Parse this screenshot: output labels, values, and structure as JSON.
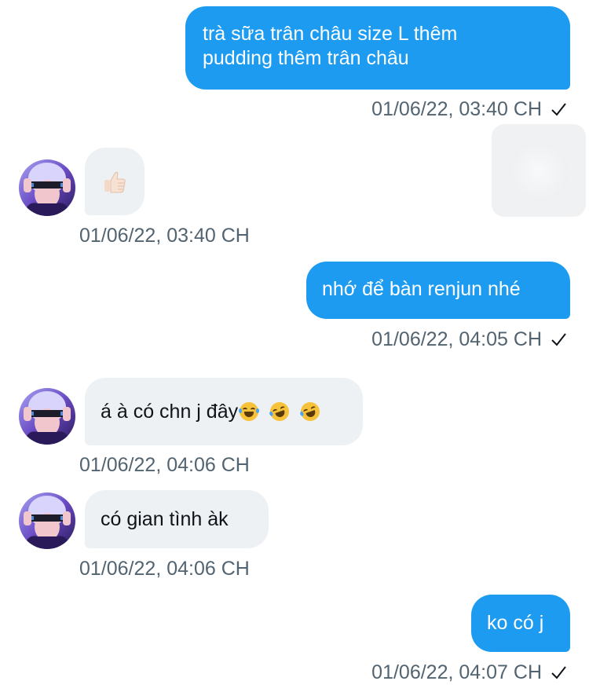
{
  "messages": [
    {
      "direction": "outgoing",
      "lines": [
        "trà sữa trân châu size L thêm",
        "pudding thêm trân châu"
      ],
      "time": "01/06/22, 03:40 CH"
    },
    {
      "direction": "incoming",
      "type": "reaction",
      "emoji_name": "thumbs-up-icon",
      "time": "01/06/22, 03:40 CH"
    },
    {
      "direction": "outgoing",
      "text": "nhớ để bàn renjun nhé",
      "time": "01/06/22, 04:05 CH"
    },
    {
      "direction": "incoming",
      "text": "á à có chn j đây",
      "emoji_names": [
        "face-with-tears-of-joy-icon",
        "rolling-on-floor-laughing-icon",
        "rolling-on-floor-laughing-icon"
      ],
      "time": "01/06/22, 04:06 CH"
    },
    {
      "direction": "incoming",
      "text": "có gian tình àk",
      "time": "01/06/22, 04:06 CH"
    },
    {
      "direction": "outgoing",
      "text": "ko có j",
      "time": "01/06/22, 04:07 CH"
    }
  ],
  "colors": {
    "outgoing_bubble": "#1d9bf0",
    "incoming_bubble": "#eef1f4",
    "meta_text": "#536471"
  }
}
